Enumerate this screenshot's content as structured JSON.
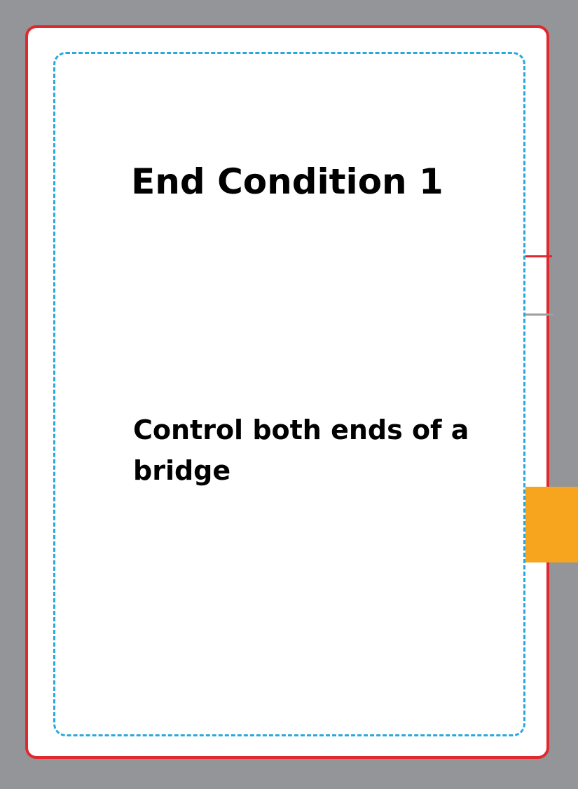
{
  "card": {
    "title": "End Condition 1",
    "text": "Control both ends of a bridge"
  },
  "colors": {
    "background": "#939598",
    "card_fill": "#ffffff",
    "cut_line": "#e0292f",
    "safe_line": "#29a8dc",
    "guide_gray": "#9d9fa2",
    "tab": "#f7a51e",
    "text": "#000000"
  }
}
